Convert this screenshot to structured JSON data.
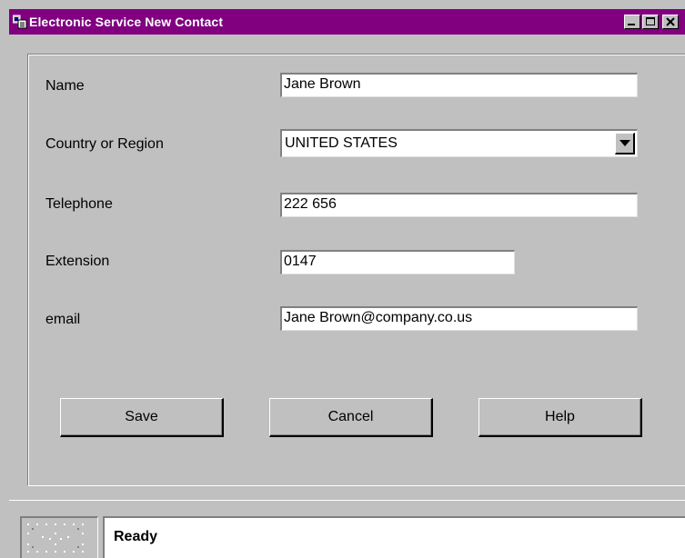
{
  "window": {
    "title": "Electronic Service New Contact",
    "title_bar_color": "#800080",
    "icon": "app-window-icon",
    "controls": [
      "minimize-icon",
      "maximize-icon",
      "close-icon"
    ]
  },
  "form": {
    "name": {
      "label": "Name",
      "value": "Jane Brown"
    },
    "country": {
      "label": "Country or Region",
      "value": "UNITED STATES",
      "icon": "chevron-down-icon"
    },
    "telephone": {
      "label": "Telephone",
      "value": "222 656"
    },
    "extension": {
      "label": "Extension",
      "value": "0147"
    },
    "email": {
      "label": "email",
      "value": "Jane Brown@company.co.us"
    }
  },
  "buttons": {
    "save": "Save",
    "cancel": "Cancel",
    "help": "Help"
  },
  "statusbar": {
    "text": "Ready",
    "icon": "status-grid-icon"
  }
}
